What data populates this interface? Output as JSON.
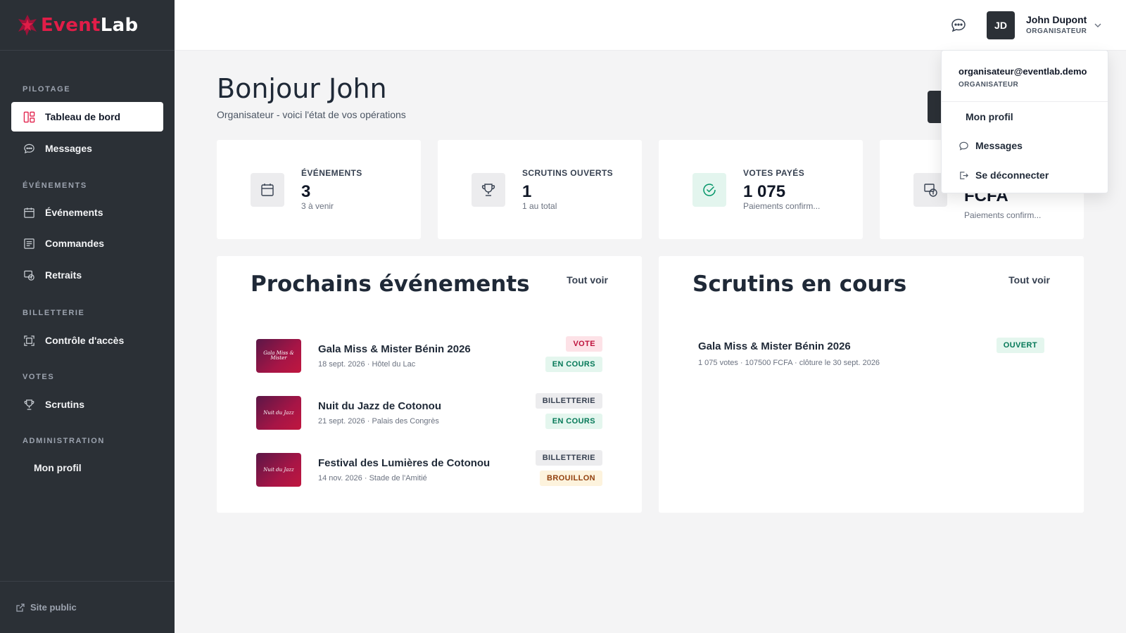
{
  "brand": {
    "name_a": "Event",
    "name_b": "Lab"
  },
  "colors": {
    "accent": "#e11d48",
    "sidebar": "#2b3036",
    "success": "#047857"
  },
  "sidebar": {
    "sections": [
      {
        "title": "PILOTAGE"
      },
      {
        "title": "ÉVÉNEMENTS"
      },
      {
        "title": "BILLETTERIE"
      },
      {
        "title": "VOTES"
      },
      {
        "title": "ADMINISTRATION"
      }
    ],
    "items": [
      {
        "label": "Tableau de bord",
        "icon": "dashboard-icon",
        "active": true
      },
      {
        "label": "Messages",
        "icon": "chat-icon"
      },
      {
        "label": "Événements",
        "icon": "calendar-icon"
      },
      {
        "label": "Commandes",
        "icon": "orders-icon"
      },
      {
        "label": "Retraits",
        "icon": "withdraw-icon"
      },
      {
        "label": "Contrôle d'accès",
        "icon": "scan-icon"
      },
      {
        "label": "Scrutins",
        "icon": "trophy-icon"
      },
      {
        "label": "Mon profil",
        "icon": ""
      }
    ],
    "footer_link": "Site public"
  },
  "topbar": {
    "avatar_initials": "JD",
    "user_name": "John Dupont",
    "user_role": "ORGANISATEUR"
  },
  "greeting": {
    "title": "Bonjour John",
    "subtitle": "Organisateur - voici l'état de vos opérations"
  },
  "stats": [
    {
      "label": "ÉVÉNEMENTS",
      "value": "3",
      "sub": "3 à venir",
      "icon": "calendar-icon"
    },
    {
      "label": "SCRUTINS OUVERTS",
      "value": "1",
      "sub": "1 au total",
      "icon": "trophy-icon"
    },
    {
      "label": "VOTES PAYÉS",
      "value": "1 075",
      "sub": "Paiements confirm...",
      "icon": "check-circle-icon"
    },
    {
      "label": "",
      "value": "FCFA",
      "sub": "Paiements confirm...",
      "icon": "money-icon"
    }
  ],
  "events_panel": {
    "title": "Prochains événements",
    "link": "Tout voir",
    "events": [
      {
        "name": "Gala Miss & Mister Bénin 2026",
        "meta": "18 sept. 2026 · Hôtel du Lac",
        "thumb": "Gala Miss & Mister",
        "badge_type": "VOTE",
        "badge_status": "EN COURS"
      },
      {
        "name": "Nuit du Jazz de Cotonou",
        "meta": "21 sept. 2026 · Palais des Congrès",
        "thumb": "Nuit du Jazz",
        "badge_type": "BILLETTERIE",
        "badge_status": "EN COURS"
      },
      {
        "name": "Festival des Lumières de Cotonou",
        "meta": "14 nov. 2026 · Stade de l'Amitié",
        "thumb": "Nuit du Jazz",
        "badge_type": "BILLETTERIE",
        "badge_status": "BROUILLON"
      }
    ]
  },
  "polls_panel": {
    "title": "Scrutins en cours",
    "link": "Tout voir",
    "polls": [
      {
        "name": "Gala Miss & Mister Bénin 2026",
        "meta": "1 075 votes · 107500 FCFA · clôture le 30 sept. 2026",
        "status": "OUVERT"
      }
    ]
  },
  "dropdown": {
    "email": "organisateur@eventlab.demo",
    "role": "ORGANISATEUR",
    "items": [
      {
        "label": "Mon profil"
      },
      {
        "label": "Messages",
        "icon": "chat-icon"
      },
      {
        "label": "Se déconnecter",
        "icon": "logout-icon"
      }
    ]
  }
}
